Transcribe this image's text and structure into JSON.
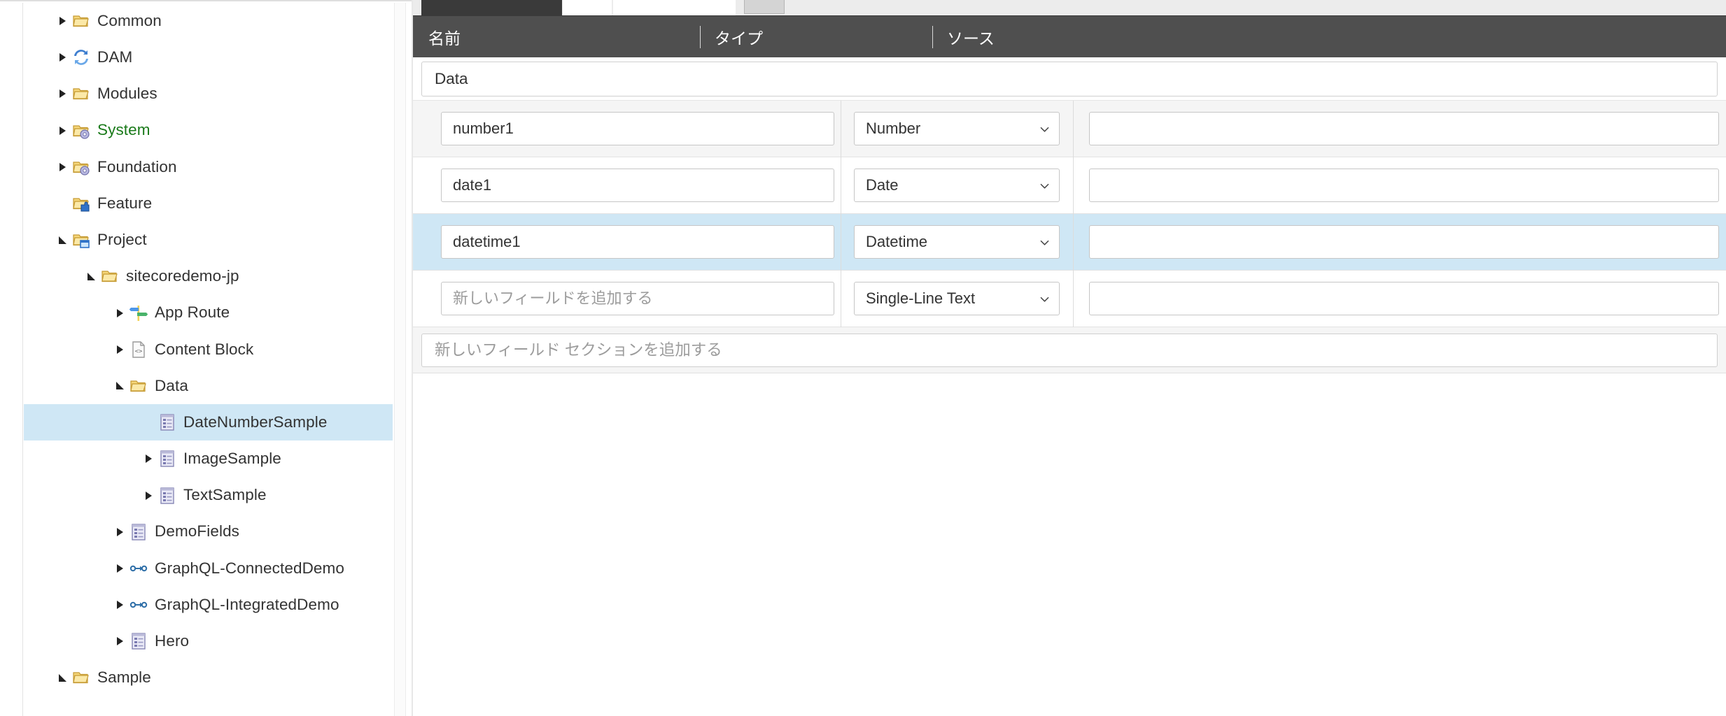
{
  "tree": {
    "items": [
      {
        "label": "Common",
        "icon": "folder-icon",
        "indent": 0,
        "twisty": "collapsed",
        "selected": false,
        "color": "default"
      },
      {
        "label": "DAM",
        "icon": "sync-icon",
        "indent": 0,
        "twisty": "collapsed",
        "selected": false,
        "color": "default"
      },
      {
        "label": "Modules",
        "icon": "folder-icon",
        "indent": 0,
        "twisty": "collapsed",
        "selected": false,
        "color": "default"
      },
      {
        "label": "System",
        "icon": "folder-gear-icon",
        "indent": 0,
        "twisty": "collapsed",
        "selected": false,
        "color": "green"
      },
      {
        "label": "Foundation",
        "icon": "folder-gear-icon",
        "indent": 0,
        "twisty": "collapsed",
        "selected": false,
        "color": "default"
      },
      {
        "label": "Feature",
        "icon": "folder-puzzle-icon",
        "indent": 0,
        "twisty": "none",
        "selected": false,
        "color": "default"
      },
      {
        "label": "Project",
        "icon": "folder-window-icon",
        "indent": 0,
        "twisty": "expanded",
        "selected": false,
        "color": "default"
      },
      {
        "label": "sitecoredemo-jp",
        "icon": "folder-icon",
        "indent": 1,
        "twisty": "expanded",
        "selected": false,
        "color": "default"
      },
      {
        "label": "App Route",
        "icon": "signpost-icon",
        "indent": 2,
        "twisty": "collapsed",
        "selected": false,
        "color": "default"
      },
      {
        "label": "Content Block",
        "icon": "code-doc-icon",
        "indent": 2,
        "twisty": "collapsed",
        "selected": false,
        "color": "default"
      },
      {
        "label": "Data",
        "icon": "folder-icon",
        "indent": 2,
        "twisty": "expanded",
        "selected": false,
        "color": "default"
      },
      {
        "label": "DateNumberSample",
        "icon": "template-icon",
        "indent": 3,
        "twisty": "none",
        "selected": true,
        "color": "default"
      },
      {
        "label": "ImageSample",
        "icon": "template-icon",
        "indent": 3,
        "twisty": "collapsed",
        "selected": false,
        "color": "default"
      },
      {
        "label": "TextSample",
        "icon": "template-icon",
        "indent": 3,
        "twisty": "collapsed",
        "selected": false,
        "color": "default"
      },
      {
        "label": "DemoFields",
        "icon": "template-icon",
        "indent": 2,
        "twisty": "collapsed",
        "selected": false,
        "color": "default"
      },
      {
        "label": "GraphQL-ConnectedDemo",
        "icon": "graphql-icon",
        "indent": 2,
        "twisty": "collapsed",
        "selected": false,
        "color": "default"
      },
      {
        "label": "GraphQL-IntegratedDemo",
        "icon": "graphql-icon",
        "indent": 2,
        "twisty": "collapsed",
        "selected": false,
        "color": "default"
      },
      {
        "label": "Hero",
        "icon": "template-icon",
        "indent": 2,
        "twisty": "collapsed",
        "selected": false,
        "color": "default"
      },
      {
        "label": "Sample",
        "icon": "folder-icon",
        "indent": 0,
        "twisty": "expanded",
        "selected": false,
        "color": "default"
      }
    ]
  },
  "builder": {
    "columns": {
      "name": "名前",
      "type": "タイプ",
      "source": "ソース"
    },
    "sections": [
      {
        "title": "Data",
        "fields": [
          {
            "name": "number1",
            "name_placeholder": "",
            "type": "Number",
            "source": "",
            "source_placeholder": "",
            "highlighted": false,
            "stripe": "alt"
          },
          {
            "name": "date1",
            "name_placeholder": "",
            "type": "Date",
            "source": "",
            "source_placeholder": "",
            "highlighted": false,
            "stripe": "plain"
          },
          {
            "name": "datetime1",
            "name_placeholder": "",
            "type": "Datetime",
            "source": "",
            "source_placeholder": "",
            "highlighted": true,
            "stripe": "plain"
          },
          {
            "name": "",
            "name_placeholder": "新しいフィールドを追加する",
            "type": "Single-Line Text",
            "source": "",
            "source_placeholder": "",
            "highlighted": false,
            "stripe": "plain"
          }
        ]
      }
    ],
    "add_section_placeholder": "新しいフィールド セクションを追加する"
  },
  "colors": {
    "header_bar": "#4f4f4f",
    "selection": "#cfe7f5",
    "tab_active": "#3a3a3a",
    "system_label": "#1a7a1a"
  }
}
